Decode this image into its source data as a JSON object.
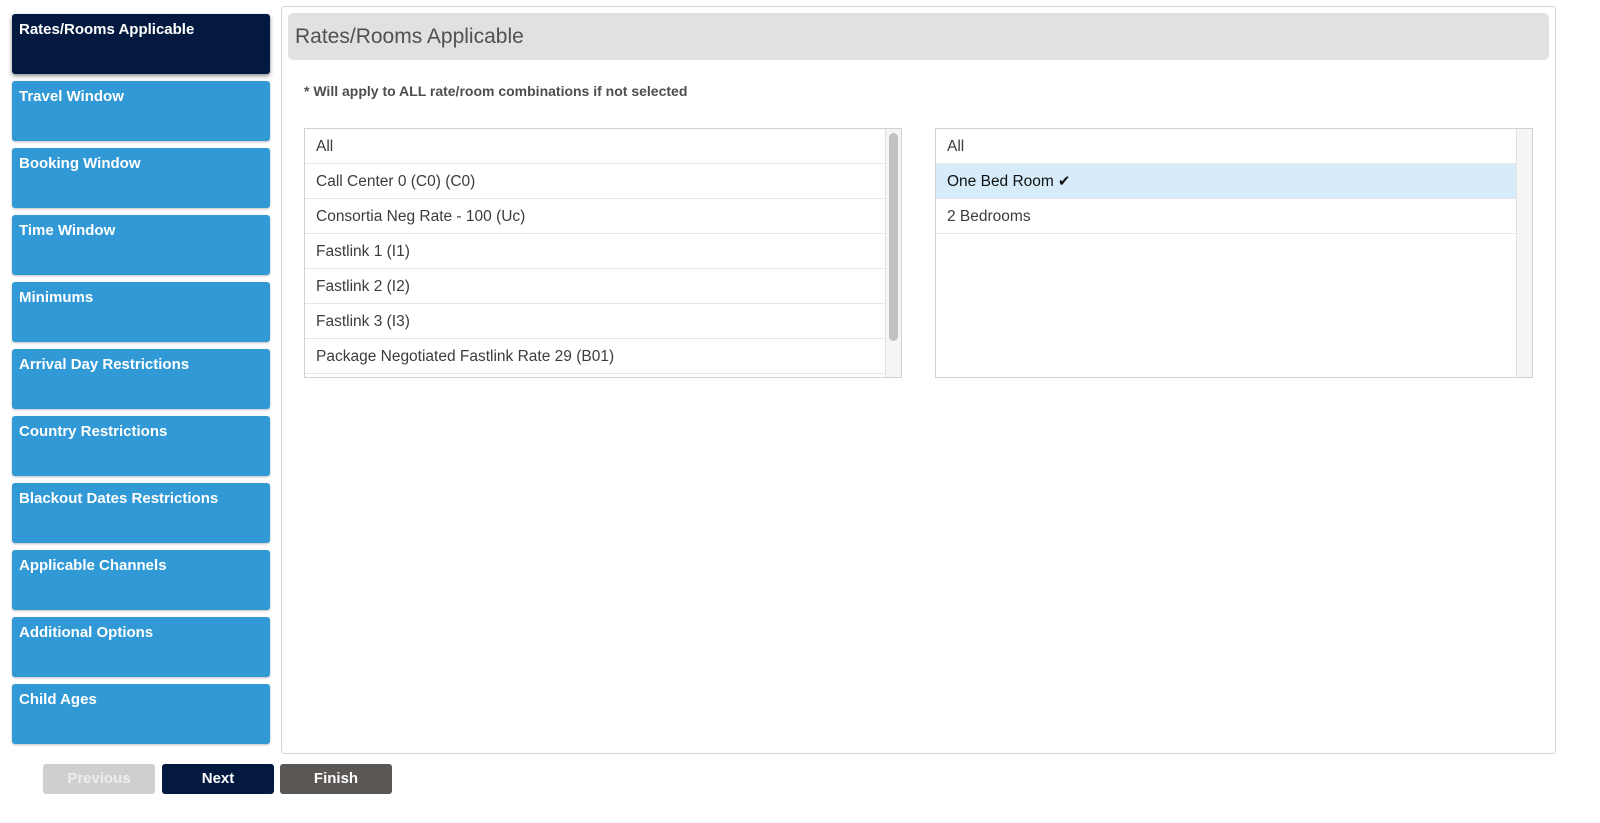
{
  "sidebar": {
    "items": [
      {
        "label": "Rates/Rooms Applicable"
      },
      {
        "label": "Travel Window"
      },
      {
        "label": "Booking Window"
      },
      {
        "label": "Time Window"
      },
      {
        "label": "Minimums"
      },
      {
        "label": "Arrival Day Restrictions"
      },
      {
        "label": "Country Restrictions"
      },
      {
        "label": "Blackout Dates Restrictions"
      },
      {
        "label": "Applicable Channels"
      },
      {
        "label": "Additional Options"
      },
      {
        "label": "Child Ages"
      }
    ]
  },
  "panel": {
    "title": "Rates/Rooms Applicable",
    "note": "* Will apply to ALL rate/room combinations if not selected"
  },
  "rates_list": {
    "items": [
      "All",
      "Call Center 0 (C0) (C0)",
      "Consortia Neg Rate - 100 (Uc)",
      "Fastlink 1 (I1)",
      "Fastlink 2 (I2)",
      "Fastlink 3 (I3)",
      "Package Negotiated Fastlink Rate 29 (B01)"
    ]
  },
  "rooms_list": {
    "items": [
      "All",
      "One Bed Room",
      "2 Bedrooms"
    ],
    "selected_check": "✔"
  },
  "buttons": {
    "previous": "Previous",
    "next": "Next",
    "finish": "Finish"
  },
  "colors": {
    "sidebar_active": "#03193f",
    "sidebar_item": "#3199d5",
    "selected_row": "#d7ecfa",
    "finish_button": "#5b5755"
  }
}
